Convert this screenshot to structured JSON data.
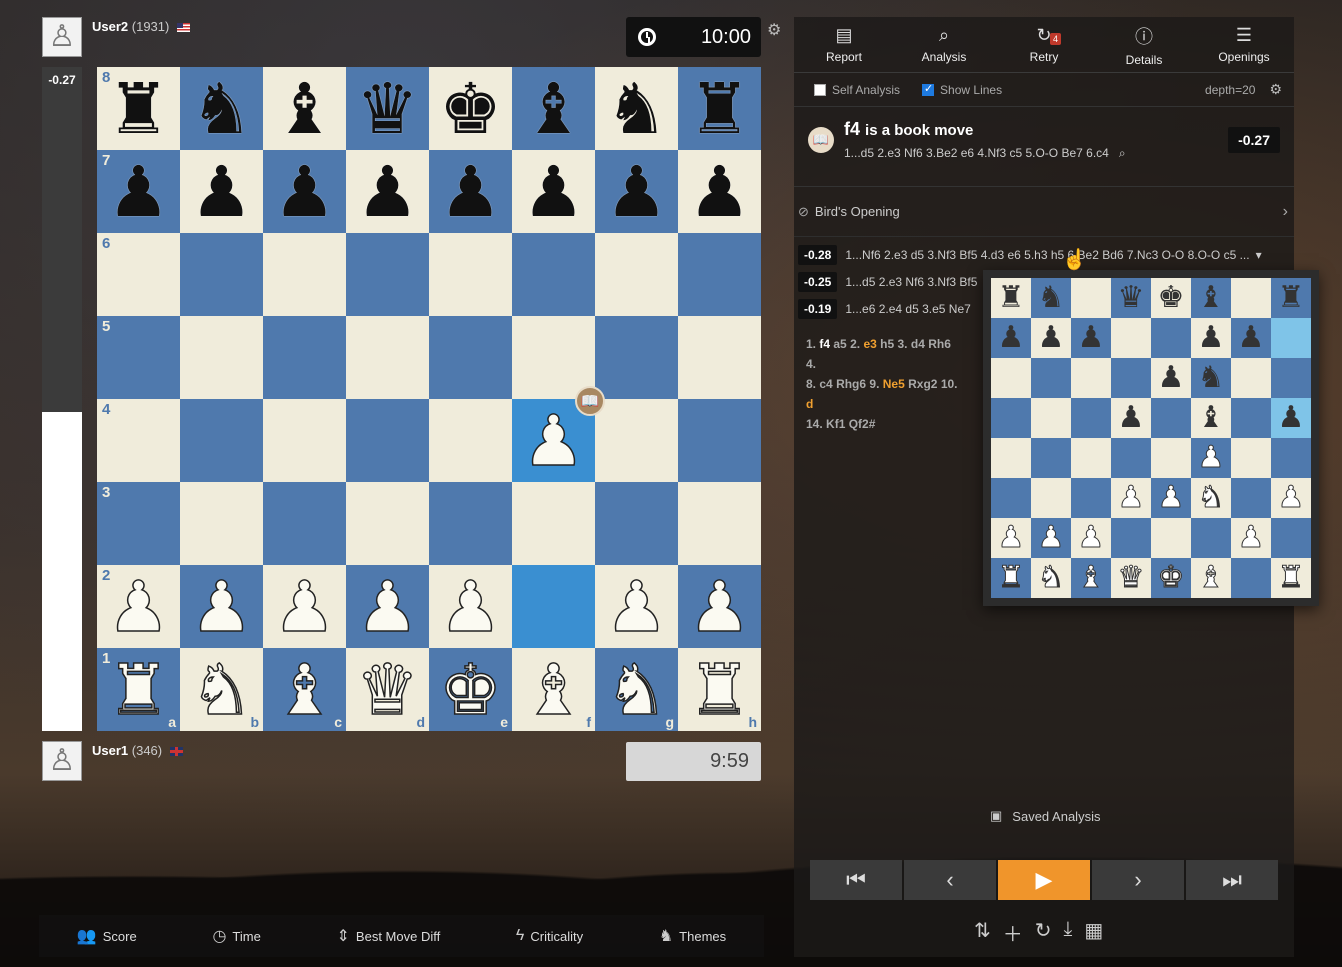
{
  "top_player": {
    "name": "User2",
    "rating": "(1931)",
    "flag": "US"
  },
  "bottom_player": {
    "name": "User1",
    "rating": "(346)",
    "flag": "GB"
  },
  "clock_top": "10:00",
  "clock_bottom": "9:59",
  "eval_bar": {
    "text": "-0.27",
    "white_fraction": 0.48
  },
  "board": {
    "ranks": [
      "8",
      "7",
      "6",
      "5",
      "4",
      "3",
      "2",
      "1"
    ],
    "files": [
      "a",
      "b",
      "c",
      "d",
      "e",
      "f",
      "g",
      "h"
    ],
    "position": [
      [
        "r",
        "n",
        "b",
        "q",
        "k",
        "b",
        "n",
        "r"
      ],
      [
        "p",
        "p",
        "p",
        "p",
        "p",
        "p",
        "p",
        "p"
      ],
      [
        "",
        "",
        "",
        "",
        "",
        "",
        "",
        ""
      ],
      [
        "",
        "",
        "",
        "",
        "",
        "",
        "",
        ""
      ],
      [
        "",
        "",
        "",
        "",
        "",
        "P",
        "",
        ""
      ],
      [
        "",
        "",
        "",
        "",
        "",
        "",
        "",
        ""
      ],
      [
        "P",
        "P",
        "P",
        "P",
        "P",
        "",
        "P",
        "P"
      ],
      [
        "R",
        "N",
        "B",
        "Q",
        "K",
        "B",
        "N",
        "R"
      ]
    ],
    "highlighted": [
      "f2",
      "f4"
    ],
    "book_badge_square": "f4"
  },
  "bottom_tabs": [
    {
      "label": "Score",
      "icon": "users-icon"
    },
    {
      "label": "Time",
      "icon": "clock-icon"
    },
    {
      "label": "Best Move Diff",
      "icon": "updown-icon"
    },
    {
      "label": "Criticality",
      "icon": "bolt-icon"
    },
    {
      "label": "Themes",
      "icon": "themes-icon"
    }
  ],
  "panel": {
    "tabs": [
      {
        "label": "Report",
        "icon": "report-icon"
      },
      {
        "label": "Analysis",
        "icon": "magnify-icon"
      },
      {
        "label": "Retry",
        "icon": "retry-icon",
        "badge": "4"
      },
      {
        "label": "Details",
        "icon": "info-icon"
      },
      {
        "label": "Openings",
        "icon": "openings-icon"
      }
    ],
    "self_analysis_label": "Self Analysis",
    "self_analysis_checked": false,
    "show_lines_label": "Show Lines",
    "show_lines_checked": true,
    "depth": "depth=20",
    "book": {
      "move": "f4",
      "text": "is a book move",
      "line": "1...d5 2.e3 Nf6 3.Be2 e6 4.Nf3 c5 5.O-O Be7 6.c4",
      "eval": "-0.27"
    },
    "opening_name": "Bird's Opening",
    "lines": [
      {
        "eval": "-0.28",
        "text": "1...Nf6 2.e3 d5 3.Nf3 Bf5 4.d3 e6 5.h3 h5 6.Be2 Bd6 7.Nc3 O-O 8.O-O c5 ..."
      },
      {
        "eval": "-0.25",
        "text": "1...d5 2.e3 Nf6 3.Nf3 Bf5"
      },
      {
        "eval": "-0.19",
        "text": "1...e6 2.e4 d5 3.e5 Ne7"
      }
    ],
    "moves_lines": [
      [
        "1.",
        "f4",
        "a5",
        "2.",
        "e3",
        "h5",
        "3.",
        "d4",
        "Rh6",
        "4."
      ],
      [
        "8.",
        "c4",
        "Rhg6",
        "9.",
        "Ne5",
        "Rxg2",
        "10.",
        "d"
      ],
      [
        "14.",
        "Kf1",
        "Qf2#"
      ]
    ],
    "saved_analysis": "Saved Analysis"
  },
  "popup_board": [
    [
      "r",
      "n",
      "",
      "q",
      "k",
      "b",
      "",
      "r"
    ],
    [
      "p",
      "p",
      "p",
      "",
      "",
      "p",
      "p",
      ""
    ],
    [
      "",
      "",
      "",
      "",
      "p",
      "n",
      "",
      ""
    ],
    [
      "",
      "",
      "",
      "p",
      "",
      "b",
      "",
      "p"
    ],
    [
      "",
      "",
      "",
      "",
      "",
      "P",
      "",
      ""
    ],
    [
      "",
      "",
      "",
      "P",
      "P",
      "N",
      "",
      "P"
    ],
    [
      "P",
      "P",
      "P",
      "",
      "",
      "",
      "P",
      ""
    ],
    [
      "R",
      "N",
      "B",
      "Q",
      "K",
      "B",
      "",
      "R"
    ]
  ],
  "popup_highlight": [
    "h7",
    "h5"
  ],
  "colors": {
    "light": "#f0ecdb",
    "dark": "#4f79ad",
    "highlight": "#3a8fd1",
    "accent": "#f0952b"
  }
}
